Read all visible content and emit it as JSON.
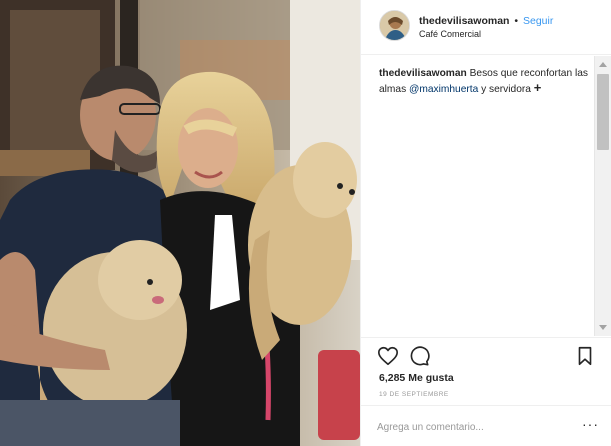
{
  "photo": {
    "alt": "photo-with-dogs"
  },
  "header": {
    "username": "thedevilisawoman",
    "separator": "•",
    "follow_label": "Seguir",
    "location": "Café Comercial"
  },
  "caption": {
    "username": "thedevilisawoman",
    "text_before": "Besos que reconfortan las almas",
    "mention": "@maximhuerta",
    "text_after": "y servidora",
    "symbol": "+"
  },
  "actions": {
    "like_icon": "heart-icon",
    "comment_icon": "speech-bubble-icon",
    "save_icon": "bookmark-icon"
  },
  "likes": {
    "label": "6,285 Me gusta"
  },
  "date": {
    "label": "19 DE SEPTIEMBRE"
  },
  "comment": {
    "placeholder": "Agrega un comentario...",
    "more_label": "···"
  },
  "colors": {
    "link_blue": "#3897f0",
    "mention_blue": "#003569",
    "border": "#efefef",
    "text": "#262626",
    "muted": "#999999"
  }
}
